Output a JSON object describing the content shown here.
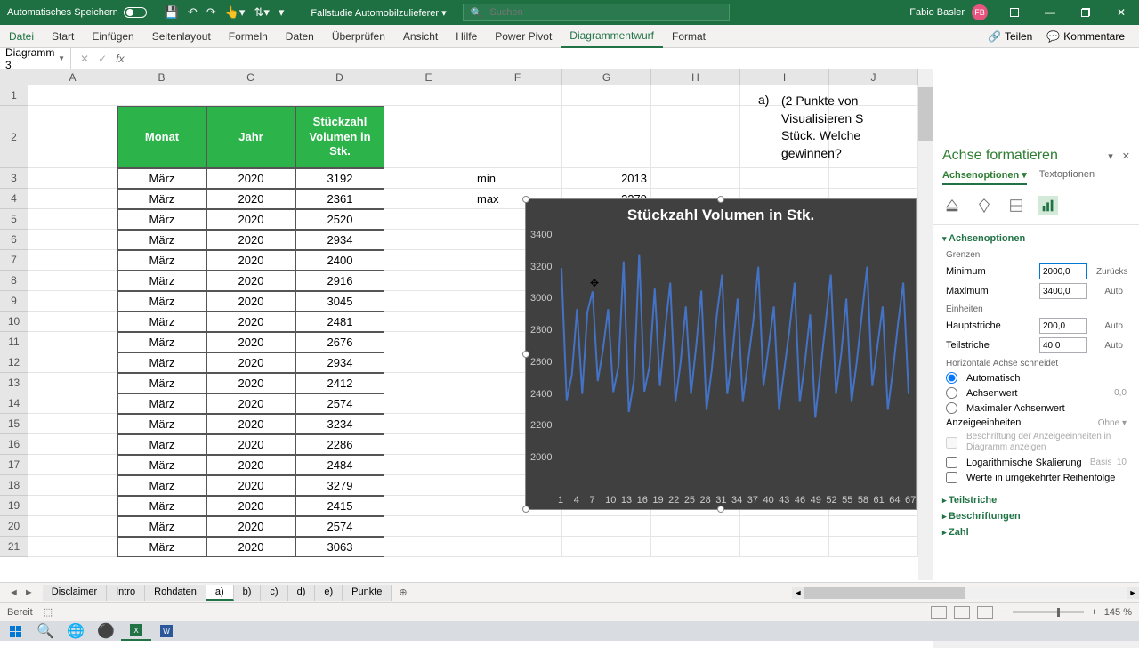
{
  "titlebar": {
    "autosave": "Automatisches Speichern",
    "filename": "Fallstudie Automobilzulieferer",
    "search_placeholder": "Suchen",
    "user": "Fabio Basler",
    "avatar": "FB"
  },
  "ribbon": {
    "tabs": [
      "Datei",
      "Start",
      "Einfügen",
      "Seitenlayout",
      "Formeln",
      "Daten",
      "Überprüfen",
      "Ansicht",
      "Hilfe",
      "Power Pivot",
      "Diagrammentwurf",
      "Format"
    ],
    "active": 10,
    "share": "Teilen",
    "comments": "Kommentare"
  },
  "formula": {
    "name": "Diagramm 3",
    "value": ""
  },
  "cols": [
    "A",
    "B",
    "C",
    "D",
    "E",
    "F",
    "G",
    "H",
    "I",
    "J"
  ],
  "rows_tall_idx": 2,
  "table": {
    "headers": [
      "Monat",
      "Jahr",
      "Stückzahl Volumen in Stk."
    ],
    "data": [
      [
        "März",
        "2020",
        "3192"
      ],
      [
        "März",
        "2020",
        "2361"
      ],
      [
        "März",
        "2020",
        "2520"
      ],
      [
        "März",
        "2020",
        "2934"
      ],
      [
        "März",
        "2020",
        "2400"
      ],
      [
        "März",
        "2020",
        "2916"
      ],
      [
        "März",
        "2020",
        "3045"
      ],
      [
        "März",
        "2020",
        "2481"
      ],
      [
        "März",
        "2020",
        "2676"
      ],
      [
        "März",
        "2020",
        "2934"
      ],
      [
        "März",
        "2020",
        "2412"
      ],
      [
        "März",
        "2020",
        "2574"
      ],
      [
        "März",
        "2020",
        "3234"
      ],
      [
        "März",
        "2020",
        "2286"
      ],
      [
        "März",
        "2020",
        "2484"
      ],
      [
        "März",
        "2020",
        "3279"
      ],
      [
        "März",
        "2020",
        "2415"
      ],
      [
        "März",
        "2020",
        "2574"
      ],
      [
        "März",
        "2020",
        "3063"
      ]
    ]
  },
  "side": {
    "min_lbl": "min",
    "min_val": "2013",
    "max_lbl": "max",
    "max_val": "3279"
  },
  "question": {
    "letter": "a)",
    "lines": [
      "(2 Punkte von",
      "Visualisieren S",
      "Stück. Welche",
      "gewinnen?"
    ]
  },
  "chart_data": {
    "type": "line",
    "title": "Stückzahl Volumen in Stk.",
    "ylim": [
      2000,
      3400
    ],
    "yticks": [
      2000,
      2200,
      2400,
      2600,
      2800,
      3000,
      3200,
      3400
    ],
    "xticks": [
      1,
      4,
      7,
      10,
      13,
      16,
      19,
      22,
      25,
      28,
      31,
      34,
      37,
      40,
      43,
      46,
      49,
      52,
      55,
      58,
      61,
      64,
      67
    ],
    "values": [
      3192,
      2361,
      2520,
      2934,
      2400,
      2916,
      3045,
      2481,
      2676,
      2934,
      2412,
      2574,
      3234,
      2286,
      2484,
      3279,
      2415,
      2574,
      3063,
      2450,
      2800,
      3100,
      2350,
      2600,
      2950,
      2400,
      2700,
      3050,
      2300,
      2550,
      2900,
      3150,
      2400,
      2650,
      3000,
      2350,
      2600,
      2850,
      3200,
      2450,
      2700,
      2950,
      2300,
      2550,
      2800,
      3100,
      2350,
      2600,
      2900,
      2250,
      2550,
      2850,
      3150,
      2400,
      2650,
      3000,
      2350,
      2600,
      2900,
      3200,
      2450,
      2700,
      2950,
      2300,
      2550,
      2850,
      3100,
      2400
    ]
  },
  "pane": {
    "title": "Achse formatieren",
    "tabs": [
      "Achsenoptionen",
      "Textoptionen"
    ],
    "section": "Achsenoptionen",
    "bounds_label": "Grenzen",
    "min_label": "Minimum",
    "min_val": "2000,0",
    "reset": "Zurücks",
    "max_label": "Maximum",
    "max_val": "3400,0",
    "auto": "Auto",
    "units_label": "Einheiten",
    "major_label": "Hauptstriche",
    "major_val": "200,0",
    "minor_label": "Teilstriche",
    "minor_val": "40,0",
    "hcross": "Horizontale Achse schneidet",
    "r1": "Automatisch",
    "r2": "Achsenwert",
    "r2_val": "0,0",
    "r3": "Maximaler Achsenwert",
    "disp": "Anzeigeeinheiten",
    "disp_val": "Ohne",
    "disp_chk": "Beschriftung der Anzeigeeinheiten in Diagramm anzeigen",
    "log": "Logarithmische Skalierung",
    "log_base": "Basis",
    "log_val": "10",
    "rev": "Werte in umgekehrter Reihenfolge",
    "s1": "Teilstriche",
    "s2": "Beschriftungen",
    "s3": "Zahl"
  },
  "sheets": {
    "tabs": [
      "Disclaimer",
      "Intro",
      "Rohdaten",
      "a)",
      "b)",
      "c)",
      "d)",
      "e)",
      "Punkte"
    ],
    "active": 3
  },
  "status": {
    "ready": "Bereit",
    "zoom": "145 %"
  }
}
